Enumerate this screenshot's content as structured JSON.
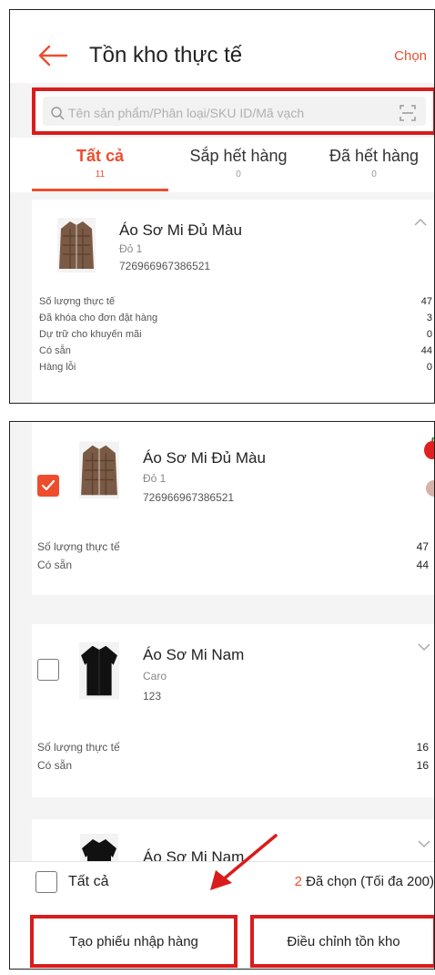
{
  "screen1": {
    "header": {
      "title": "Tồn kho thực tế",
      "choose_label": "Chọn"
    },
    "search": {
      "placeholder": "Tên sản phẩm/Phân loại/SKU ID/Mã vạch"
    },
    "tabs": [
      {
        "label": "Tất cả",
        "count": "11",
        "active": true
      },
      {
        "label": "Sắp hết hàng",
        "count": "0",
        "active": false
      },
      {
        "label": "Đã hết hàng",
        "count": "0",
        "active": false
      }
    ],
    "product": {
      "name": "Áo Sơ Mi Đủ Màu",
      "variant": "Đỏ 1",
      "sku": "726966967386521",
      "stats": [
        {
          "label": "Số lượng thực tế",
          "value": "47"
        },
        {
          "label": "Đã khóa cho đơn đặt hàng",
          "value": "3"
        },
        {
          "label": "Dự trữ cho khuyến mãi",
          "value": "0"
        },
        {
          "label": "Có sẵn",
          "value": "44"
        },
        {
          "label": "Hàng lỗi",
          "value": "0"
        }
      ]
    }
  },
  "screen2": {
    "products": [
      {
        "name": "Áo Sơ Mi Đủ Màu",
        "variant": "Đỏ 1",
        "sku": "726966967386521",
        "checked": true,
        "stats": [
          {
            "label": "Số lượng thực tế",
            "value": "47"
          },
          {
            "label": "Có sẵn",
            "value": "44"
          }
        ]
      },
      {
        "name": "Áo Sơ Mi Nam",
        "variant": "Caro",
        "sku": "123",
        "checked": false,
        "stats": [
          {
            "label": "Số lượng thực tế",
            "value": "16"
          },
          {
            "label": "Có sẵn",
            "value": "16"
          }
        ]
      },
      {
        "name": "Áo Sơ Mi Nam"
      }
    ],
    "bottom": {
      "select_all_label": "Tất cả",
      "selected_count": "2",
      "selected_text": " Đã chọn (Tối đa 200)",
      "create_receipt_label": "Tạo phiếu nhập hàng",
      "adjust_stock_label": "Điều chỉnh tồn kho"
    }
  },
  "colors": {
    "accent": "#ee4d2d",
    "highlight_box": "#d91c1c"
  }
}
